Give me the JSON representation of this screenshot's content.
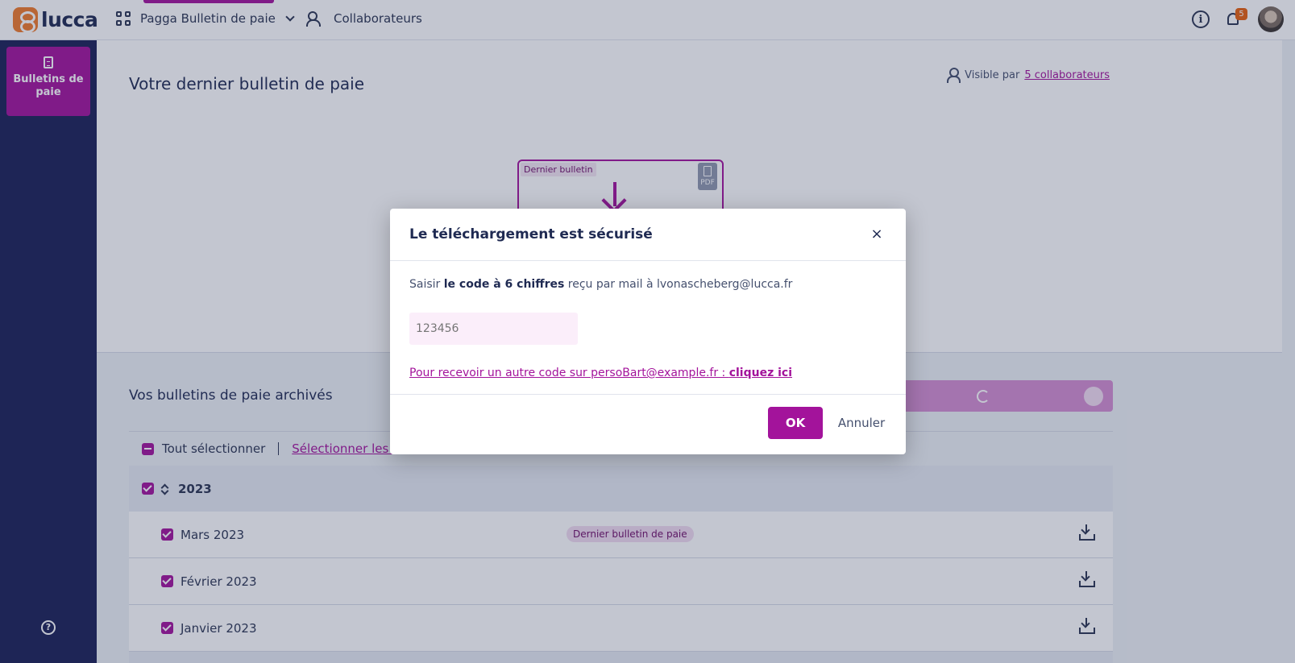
{
  "topbar": {
    "logo_text": "lucca",
    "app_name": "Pagga Bulletin de paie",
    "collaborators_label": "Collaborateurs",
    "info_icon": "info-icon",
    "notification_count": "5"
  },
  "sidebar": {
    "active_item_label": "Bulletins de paie",
    "help_icon": "help-icon"
  },
  "hero": {
    "title": "Votre dernier bulletin de paie",
    "visibility_prefix": "Visible par",
    "visibility_link": "5 collaborateurs",
    "card_tag": "Dernier bulletin",
    "pdf_label": "PDF"
  },
  "archive": {
    "title": "Vos bulletins de paie archivés",
    "select_all_label": "Tout sélectionner",
    "select_link": "Sélectionner les 3 de",
    "year": "2023",
    "months": [
      {
        "label": "Mars 2023",
        "badge": "Dernier bulletin de paie"
      },
      {
        "label": "Février 2023",
        "badge": ""
      },
      {
        "label": "Janvier 2023",
        "badge": ""
      }
    ]
  },
  "modal": {
    "title": "Le téléchargement est sécurisé",
    "close_label": "×",
    "instruction_prefix": "Saisir ",
    "instruction_bold": "le code à 6 chiffres",
    "instruction_suffix": " reçu par mail à lvonascheberg@lucca.fr",
    "code_placeholder": "123456",
    "resend_prefix": "Pour recevoir un autre code sur persoBart@example.fr : ",
    "resend_link": "cliquez ici",
    "ok_label": "OK",
    "cancel_label": "Annuler"
  },
  "colors": {
    "brand_primary": "#a3139b",
    "sidebar_bg": "#1b2157",
    "logo_orange": "#f07a2a",
    "notification_badge": "#e8600d"
  }
}
